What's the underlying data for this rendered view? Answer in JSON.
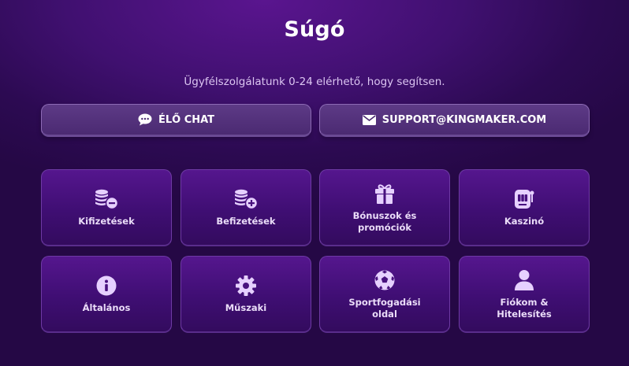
{
  "header": {
    "title": "Súgó",
    "subtitle": "Ügyfélszolgálatunk 0-24 elérhető, hogy segítsen."
  },
  "contact": {
    "chat_label": "ÉLŐ CHAT",
    "chat_icon": "chat-bubble-icon",
    "email_label": "SUPPORT@KINGMAKER.COM",
    "email_icon": "envelope-icon"
  },
  "categories": [
    {
      "label": "Kifizetések",
      "icon": "coins-minus-icon"
    },
    {
      "label": "Befizetések",
      "icon": "coins-plus-icon"
    },
    {
      "label": "Bónuszok és promóciók",
      "icon": "gift-icon"
    },
    {
      "label": "Kaszinó",
      "icon": "slot-machine-icon"
    },
    {
      "label": "Általános",
      "icon": "info-icon"
    },
    {
      "label": "Műszaki",
      "icon": "gear-icon"
    },
    {
      "label": "Sportfogadási oldal",
      "icon": "soccer-ball-icon"
    },
    {
      "label": "Fiókom & Hitelesítés",
      "icon": "user-icon"
    }
  ],
  "colors": {
    "background": "#3a0d66",
    "icon": "#e6d0ff",
    "button_border": "#8d6ab5"
  }
}
